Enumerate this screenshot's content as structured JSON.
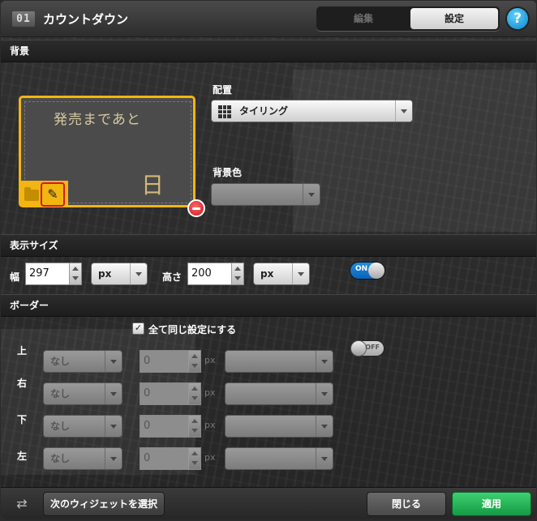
{
  "window": {
    "number_badge": "01",
    "title": "カウントダウン",
    "tabs": [
      {
        "label": "編集",
        "active": false
      },
      {
        "label": "設定",
        "active": true
      }
    ],
    "help": "?"
  },
  "background": {
    "section_title": "背景",
    "preview": {
      "text": "発売まであと",
      "day_text": "日"
    },
    "placement": {
      "label": "配置",
      "value": "タイリング"
    },
    "bg_color": {
      "label": "背景色"
    }
  },
  "display_size": {
    "section_title": "表示サイズ",
    "width_label": "幅",
    "width_value": "297",
    "width_unit": "px",
    "height_label": "高さ",
    "height_value": "200",
    "height_unit": "px",
    "toggle_label": "ON"
  },
  "border": {
    "section_title": "ボーダー",
    "same_setting_label": "全て同じ設定にする",
    "same_setting_checked": true,
    "toggle_label": "OFF",
    "rows": [
      {
        "side": "上",
        "style": "なし",
        "value": "0",
        "unit": "px"
      },
      {
        "side": "右",
        "style": "なし",
        "value": "0",
        "unit": "px"
      },
      {
        "side": "下",
        "style": "なし",
        "value": "0",
        "unit": "px"
      },
      {
        "side": "左",
        "style": "なし",
        "value": "0",
        "unit": "px"
      }
    ]
  },
  "footer": {
    "next_widget_label": "次のウィジェットを選択",
    "close_label": "閉じる",
    "apply_label": "適用"
  },
  "colors": {
    "accent": "#f2b511",
    "apply": "#1fb355",
    "toggle_on": "#0a6fcc",
    "help": "#1a9fe0",
    "remove": "#d01a2c"
  }
}
